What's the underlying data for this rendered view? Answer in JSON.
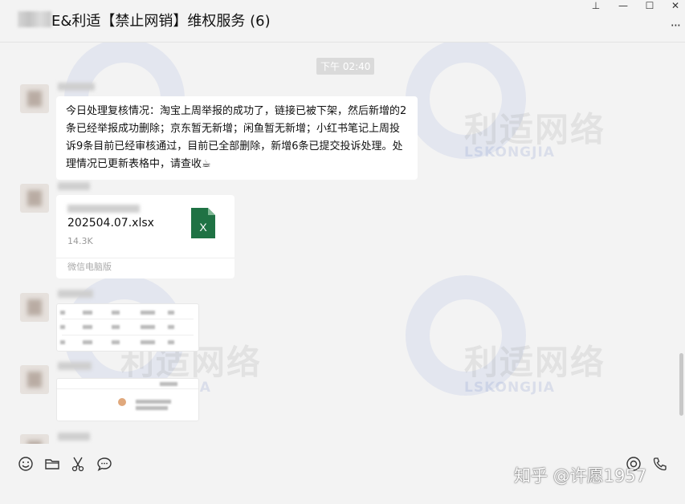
{
  "window": {
    "title": "E&利适【禁止网销】维权服务 (6)",
    "controls": {
      "pin": "⊥",
      "minimize": "—",
      "maximize": "☐",
      "close": "✕"
    },
    "more": "···"
  },
  "chat": {
    "timestamp": "下午 02:40",
    "messages": [
      {
        "type": "text",
        "text": "今日处理复核情况：淘宝上周举报的成功了，链接已被下架，然后新增的2条已经举报成功删除；京东暂无新增；闲鱼暂无新增；小红书笔记上周投诉9条目前已经审核通过，目前已全部删除，新增6条已提交投诉处理。处理情况已更新表格中，请查收☕"
      },
      {
        "type": "file",
        "file_name": "202504.07.xlsx",
        "file_size": "14.3K",
        "source": "微信电脑版",
        "icon": "excel-icon",
        "icon_color": "#1f7244"
      },
      {
        "type": "image"
      },
      {
        "type": "image"
      }
    ]
  },
  "watermark": {
    "cn": "利适网络",
    "en": "LSKONGJIA"
  },
  "toolbar": {
    "tools": [
      {
        "name": "emoji-icon"
      },
      {
        "name": "folder-icon"
      },
      {
        "name": "scissors-icon"
      },
      {
        "name": "chat-bubble-icon"
      },
      {
        "name": "live-icon"
      },
      {
        "name": "phone-icon"
      }
    ]
  },
  "signature": "知乎 @许愿1957"
}
